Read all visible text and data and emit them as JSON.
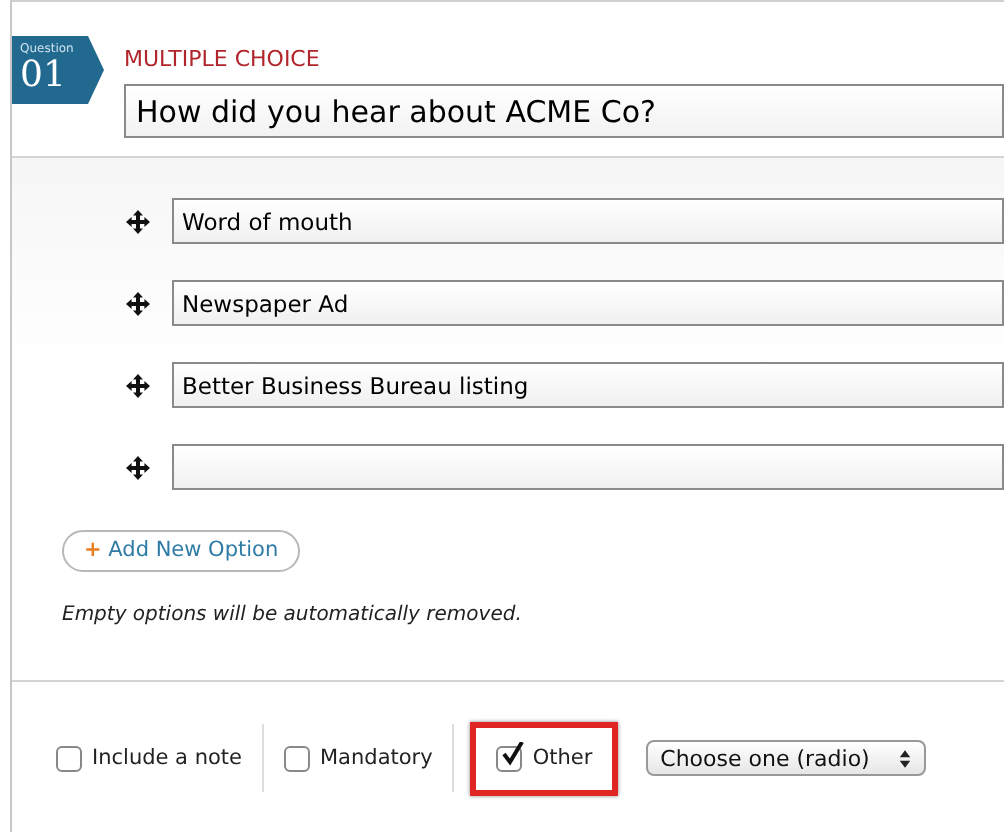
{
  "badge": {
    "label": "Question",
    "number": "01"
  },
  "question_type": "MULTIPLE CHOICE",
  "question": {
    "value": "How did you hear about ACME Co?"
  },
  "options": [
    {
      "kind": "filled",
      "value": "Word of mouth"
    },
    {
      "kind": "filled",
      "value": "Newspaper Ad"
    },
    {
      "kind": "filled",
      "value": "Better Business Bureau listing"
    },
    {
      "kind": "blank"
    }
  ],
  "add_option": {
    "icon": "+",
    "label": "Add New Option"
  },
  "note": "Empty options will be automatically removed.",
  "settings": [
    {
      "label": "Include a note",
      "checked": false,
      "highlighted": false
    },
    {
      "label": "Mandatory",
      "checked": false,
      "highlighted": false
    },
    {
      "label": "Other",
      "checked": true,
      "highlighted": true
    }
  ],
  "answer_type": {
    "value": "Choose one (radio)"
  }
}
